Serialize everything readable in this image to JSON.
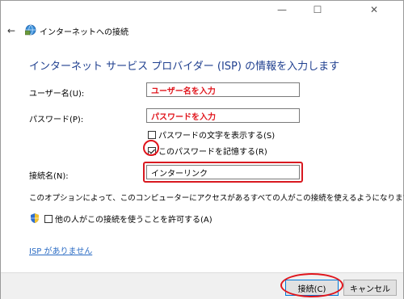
{
  "window": {
    "minimize_glyph": "—",
    "maximize_glyph": "☐",
    "close_glyph": "✕"
  },
  "nav": {
    "back_glyph": "←",
    "breadcrumb": "インターネットへの接続",
    "icon": "network-globe-icon"
  },
  "heading": "インターネット サービス プロバイダー (ISP) の情報を入力します",
  "form": {
    "username_label": "ユーザー名(U):",
    "username_value": "ユーザー名を入力",
    "password_label": "パスワード(P):",
    "password_value": "パスワードを入力",
    "show_chars_label": "パスワードの文字を表示する(S)",
    "show_chars_checked": false,
    "remember_label": "このパスワードを記憶する(R)",
    "remember_checked": true,
    "conn_name_label": "接続名(N):",
    "conn_name_value": "インターリンク"
  },
  "description": "このオプションによって、このコンピューターにアクセスがあるすべての人がこの接続を使えるようになります。",
  "share": {
    "label": "他の人がこの接続を使うことを許可する(A)",
    "checked": false,
    "icon": "uac-shield-icon"
  },
  "no_isp_link": "ISP がありません",
  "buttons": {
    "connect": "接続(C)",
    "cancel": "キャンセル"
  },
  "colors": {
    "annotation_red": "#e0151c",
    "heading_blue": "#1f3f8f",
    "link_blue": "#2b6cc4"
  }
}
